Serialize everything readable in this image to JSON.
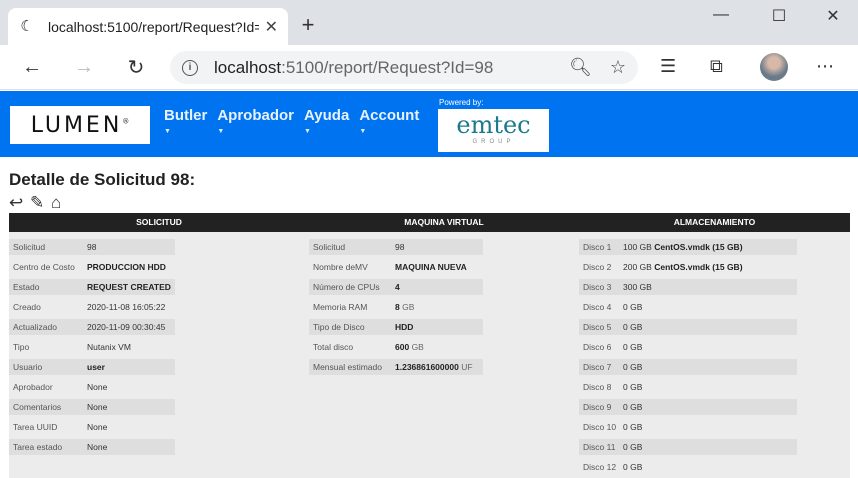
{
  "browser": {
    "tab_title": "localhost:5100/report/Request?Id=98",
    "url_host": "localhost",
    "url_rest": ":5100/report/Request?Id=98"
  },
  "header": {
    "logo_text": "LUMEN",
    "logo_mark": "®",
    "menu": [
      "Butler",
      "Aprobador",
      "Ayuda",
      "Account"
    ],
    "powered_by": "Powered by:",
    "partner_name": "emtec",
    "partner_sub": "GROUP",
    "bg_color": "#0073f0"
  },
  "page": {
    "title": "Detalle de Solicitud 98:"
  },
  "sections": {
    "solicitud": "SOLICITUD",
    "vm": "MAQUINA VIRTUAL",
    "storage": "ALMACENAMIENTO"
  },
  "solicitud": [
    {
      "k": "Solicitud",
      "v": "98",
      "bold": false
    },
    {
      "k": "Centro de Costo",
      "v": "PRODUCCION HDD",
      "bold": true
    },
    {
      "k": "Estado",
      "v": "REQUEST CREATED",
      "bold": true
    },
    {
      "k": "Creado",
      "v": "2020-11-08 16:05:22",
      "bold": false
    },
    {
      "k": "Actualizado",
      "v": "2020-11-09 00:30:45",
      "bold": false
    },
    {
      "k": "Tipo",
      "v": "Nutanix VM",
      "bold": false
    },
    {
      "k": "Usuario",
      "v": "user",
      "bold": true
    },
    {
      "k": "Aprobador",
      "v": "None",
      "bold": false
    },
    {
      "k": "Comentarios",
      "v": "None",
      "bold": false
    },
    {
      "k": "Tarea UUID",
      "v": "None",
      "bold": false
    },
    {
      "k": "Tarea estado",
      "v": "None",
      "bold": false
    }
  ],
  "vm": [
    {
      "k": "Solicitud",
      "v": "98",
      "unit": "",
      "bold": false
    },
    {
      "k": "Nombre deMV",
      "v": "MAQUINA NUEVA",
      "unit": "",
      "bold": true
    },
    {
      "k": "Número de CPUs",
      "v": "4",
      "unit": "",
      "bold": true
    },
    {
      "k": "Memoria RAM",
      "v": "8",
      "unit": "GB",
      "bold": true
    },
    {
      "k": "Tipo de Disco",
      "v": "HDD",
      "unit": "",
      "bold": true
    },
    {
      "k": "Total disco",
      "v": "600",
      "unit": "GB",
      "bold": true
    },
    {
      "k": "Mensual estimado",
      "v": "1.236861600000",
      "unit": "UF",
      "bold": true
    }
  ],
  "storage": [
    {
      "k": "Disco 1",
      "v": "100 GB",
      "img": "CentOS.vmdk (15 GB)"
    },
    {
      "k": "Disco 2",
      "v": "200 GB",
      "img": "CentOS.vmdk (15 GB)"
    },
    {
      "k": "Disco 3",
      "v": "300 GB",
      "img": ""
    },
    {
      "k": "Disco 4",
      "v": "0 GB",
      "img": ""
    },
    {
      "k": "Disco 5",
      "v": "0 GB",
      "img": ""
    },
    {
      "k": "Disco 6",
      "v": "0 GB",
      "img": ""
    },
    {
      "k": "Disco 7",
      "v": "0 GB",
      "img": ""
    },
    {
      "k": "Disco 8",
      "v": "0 GB",
      "img": ""
    },
    {
      "k": "Disco 9",
      "v": "0 GB",
      "img": ""
    },
    {
      "k": "Disco 10",
      "v": "0 GB",
      "img": ""
    },
    {
      "k": "Disco 11",
      "v": "0 GB",
      "img": ""
    },
    {
      "k": "Disco 12",
      "v": "0 GB",
      "img": ""
    }
  ]
}
